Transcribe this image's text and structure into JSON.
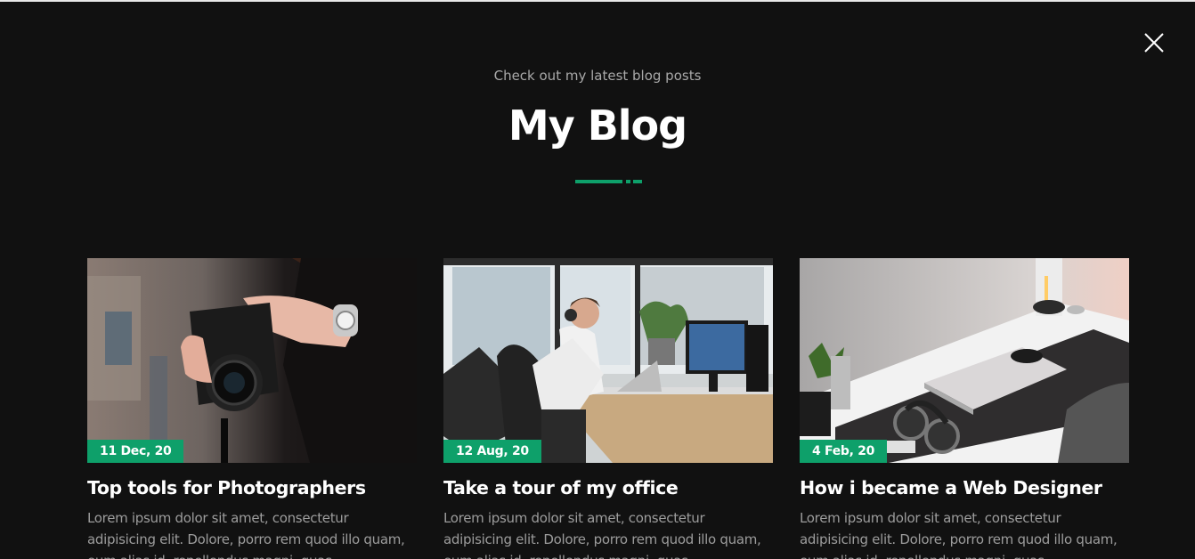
{
  "header": {
    "subtitle": "Check out my latest blog posts",
    "title": "My Blog"
  },
  "close": {
    "icon": "close-icon"
  },
  "theme": {
    "background": "#111111",
    "accent": "#0ea06a",
    "text": "#ffffff",
    "muted": "#9c9c9c"
  },
  "posts": [
    {
      "date": "11 Dec, 20",
      "title": "Top tools for Photographers",
      "excerpt": "Lorem ipsum dolor sit amet, consectetur adipisicing elit. Dolore, porro rem quod illo quam, eum alias id, repellendus magni, quas.",
      "image": "photographer-with-camera"
    },
    {
      "date": "12 Aug, 20",
      "title": "Take a tour of my office",
      "excerpt": "Lorem ipsum dolor sit amet, consectetur adipisicing elit. Dolore, porro rem quod illo quam, eum alias id, repellendus magni, quas.",
      "image": "man-at-office-desk"
    },
    {
      "date": "4 Feb, 20",
      "title": "How i became a Web Designer",
      "excerpt": "Lorem ipsum dolor sit amet, consectetur adipisicing elit. Dolore, porro rem quod illo quam, eum alias id, repellendus magni, quas.",
      "image": "desk-with-laptop-and-headphones"
    }
  ]
}
